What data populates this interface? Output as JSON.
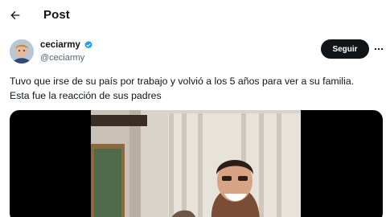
{
  "header": {
    "title": "Post",
    "back_icon": "arrow-left-icon"
  },
  "author": {
    "display_name": "ceciarmy",
    "handle": "@ceciarmy",
    "verified": true,
    "verified_color": "#1d9bf0"
  },
  "actions": {
    "follow_label": "Seguir",
    "more_icon": "more-horizontal-icon"
  },
  "tweet": {
    "lines": [
      "Tuvo que irse de su país por trabajo y volvió a los 5 años para ver a su familia.",
      "Esta fue la reacción de sus padres"
    ]
  },
  "media": {
    "type": "video"
  },
  "colors": {
    "text": "#0f1419",
    "secondary_text": "#536471",
    "follow_bg": "#0f1419",
    "accent": "#1d9bf0"
  }
}
